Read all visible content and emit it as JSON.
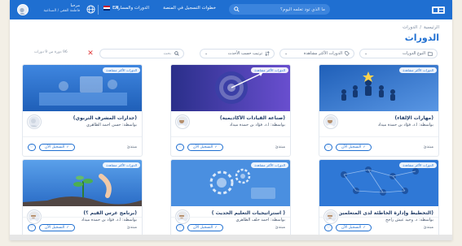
{
  "topbar": {
    "search_placeholder": "ما الذي تود تعلمه اليوم؟",
    "nav": [
      "خطوات التسجيل في المنصة",
      "الدورات والمسارات"
    ],
    "lang": "EN",
    "user_name": "مرحبا",
    "user_sub": "فاطمة الفقي / الصناعية"
  },
  "breadcrumb": [
    "الرئيسية",
    "الدورات"
  ],
  "page_title": "الدورات",
  "filters": {
    "type": "النوع الدورات",
    "category": "الدورات الأكثر مشاهدة",
    "sort": "ترتيب حسب الأحدث",
    "search_placeholder": "بحث",
    "results": "96 دورة من 9 دورات"
  },
  "cards": [
    {
      "badge": "الدورات الأكثر مشاهدة",
      "title": "(مهارات الإلقاء)",
      "instructor": "بواسطة: أ.د. فؤاد بن حمدة ميداد",
      "level": "مبتدئ",
      "enroll": "التسجيل الآن",
      "theme": "leadership"
    },
    {
      "badge": "الدورات الأكثر مشاهدة",
      "title": "(صناعة القيادات الأكاديمية)",
      "instructor": "بواسطة: أ.د. فؤاد بن حمدة ميداد",
      "level": "مبتدئ",
      "enroll": "التسجيل الآن",
      "theme": "target"
    },
    {
      "badge": "الدورات الأكثر مشاهدة",
      "title": "(جدارات المشرف التربوي)",
      "instructor": "بواسطة: حسن احمد الظاهري",
      "level": "مبتدئ",
      "enroll": "التسجيل الآن",
      "theme": "office"
    },
    {
      "badge": "الدورات الأكثر مشاهدة",
      "title": "(التخطيط وإدارة الخاطئة لدى المتعلمين)",
      "instructor": "بواسطة: د. وحيد عيش راجح",
      "level": "مبتدئ",
      "enroll": "التسجيل الآن",
      "theme": "network"
    },
    {
      "badge": "الدورات الأكثر مشاهدة",
      "title": "( استراتيجيات التعليم الحديث )",
      "instructor": "بواسطة: احمد خلف الظاهري",
      "level": "مبتدئ",
      "enroll": "التسجيل الآن",
      "theme": "gears"
    },
    {
      "badge": "الدورات الأكثر مشاهدة",
      "title": "(برنامج غرس القيم ؟)",
      "instructor": "بواسطة: أ.د. فؤاد بن حمدة ميداد",
      "level": "مبتدئ",
      "enroll": "التسجيل الآن",
      "theme": "plant"
    }
  ],
  "colors": {
    "primary": "#1f6fd1",
    "title_dark": "#1f3b66",
    "clear": "#e23b3b"
  }
}
